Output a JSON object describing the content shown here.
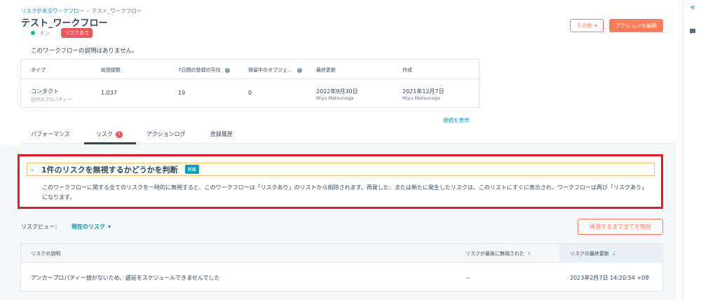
{
  "breadcrumb": {
    "parent": "リスクがあるワークフロー",
    "separator": "›",
    "current": "テスト_ワークフロー"
  },
  "header": {
    "title": "テスト_ワークフロー",
    "status": "オン",
    "risk_badge": "リスクあり",
    "other_button": "その他",
    "edit_button": "アクションを編集"
  },
  "description": "このワークフローの説明はありません。",
  "stats": {
    "headers": [
      "タイプ",
      "総登録数",
      "7日間の登録の平均",
      "保留中のオブジェ…",
      "最終更新",
      "作成"
    ],
    "type_value": "コンタクト",
    "type_sub": "日付のプロパティー",
    "total": "1,037",
    "avg7": "19",
    "pending": "0",
    "updated": "2022年9月30日",
    "updated_by": "Miyu Matsunaga",
    "created": "2021年12月7日",
    "created_by": "Miyu Matsunaga"
  },
  "show_connections": "接続を表示",
  "tabs": {
    "performance": "パフォーマンス",
    "risk": "リスク",
    "risk_count": "1",
    "action_log": "アクションログ",
    "history": "登録履歴"
  },
  "notice": {
    "title": "1件のリスクを無視するかどうかを判断",
    "badge": "新機",
    "body": "このワークフローに関する全てのリスクを一時的に無視すると、このワークフローは「リスクあり」のリストから削除されます。再発した、または新たに発生したリスクは、このリストにすぐに表示され、ワークフローは再び「リスクあり」になります。"
  },
  "risk_view": {
    "label": "リスクビュー：",
    "value": "現在のリスク"
  },
  "ignore_button": "再発するまで全てを無視",
  "risk_table": {
    "headers": [
      "リスクの説明",
      "リスクが最後に無視された",
      "リスクの最終更新"
    ],
    "row": {
      "description": "アンカープロパティー値がないため、遅延をスケジュールできませんでした",
      "last_ignored": "--",
      "last_updated": "2023年2月7日 14:20:54 +09"
    }
  },
  "colors": {
    "accent": "#ff7a59",
    "link": "#0091ae",
    "danger": "#f2545b",
    "highlight_frame": "#e31d1d"
  }
}
